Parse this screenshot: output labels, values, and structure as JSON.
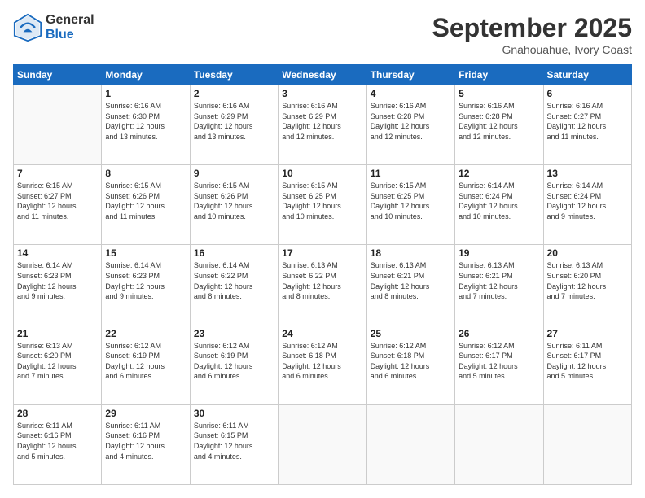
{
  "header": {
    "logo_line1": "General",
    "logo_line2": "Blue",
    "month": "September 2025",
    "location": "Gnahouahue, Ivory Coast"
  },
  "days_of_week": [
    "Sunday",
    "Monday",
    "Tuesday",
    "Wednesday",
    "Thursday",
    "Friday",
    "Saturday"
  ],
  "weeks": [
    [
      {
        "day": "",
        "info": ""
      },
      {
        "day": "1",
        "info": "Sunrise: 6:16 AM\nSunset: 6:30 PM\nDaylight: 12 hours\nand 13 minutes."
      },
      {
        "day": "2",
        "info": "Sunrise: 6:16 AM\nSunset: 6:29 PM\nDaylight: 12 hours\nand 13 minutes."
      },
      {
        "day": "3",
        "info": "Sunrise: 6:16 AM\nSunset: 6:29 PM\nDaylight: 12 hours\nand 12 minutes."
      },
      {
        "day": "4",
        "info": "Sunrise: 6:16 AM\nSunset: 6:28 PM\nDaylight: 12 hours\nand 12 minutes."
      },
      {
        "day": "5",
        "info": "Sunrise: 6:16 AM\nSunset: 6:28 PM\nDaylight: 12 hours\nand 12 minutes."
      },
      {
        "day": "6",
        "info": "Sunrise: 6:16 AM\nSunset: 6:27 PM\nDaylight: 12 hours\nand 11 minutes."
      }
    ],
    [
      {
        "day": "7",
        "info": "Sunrise: 6:15 AM\nSunset: 6:27 PM\nDaylight: 12 hours\nand 11 minutes."
      },
      {
        "day": "8",
        "info": "Sunrise: 6:15 AM\nSunset: 6:26 PM\nDaylight: 12 hours\nand 11 minutes."
      },
      {
        "day": "9",
        "info": "Sunrise: 6:15 AM\nSunset: 6:26 PM\nDaylight: 12 hours\nand 10 minutes."
      },
      {
        "day": "10",
        "info": "Sunrise: 6:15 AM\nSunset: 6:25 PM\nDaylight: 12 hours\nand 10 minutes."
      },
      {
        "day": "11",
        "info": "Sunrise: 6:15 AM\nSunset: 6:25 PM\nDaylight: 12 hours\nand 10 minutes."
      },
      {
        "day": "12",
        "info": "Sunrise: 6:14 AM\nSunset: 6:24 PM\nDaylight: 12 hours\nand 10 minutes."
      },
      {
        "day": "13",
        "info": "Sunrise: 6:14 AM\nSunset: 6:24 PM\nDaylight: 12 hours\nand 9 minutes."
      }
    ],
    [
      {
        "day": "14",
        "info": "Sunrise: 6:14 AM\nSunset: 6:23 PM\nDaylight: 12 hours\nand 9 minutes."
      },
      {
        "day": "15",
        "info": "Sunrise: 6:14 AM\nSunset: 6:23 PM\nDaylight: 12 hours\nand 9 minutes."
      },
      {
        "day": "16",
        "info": "Sunrise: 6:14 AM\nSunset: 6:22 PM\nDaylight: 12 hours\nand 8 minutes."
      },
      {
        "day": "17",
        "info": "Sunrise: 6:13 AM\nSunset: 6:22 PM\nDaylight: 12 hours\nand 8 minutes."
      },
      {
        "day": "18",
        "info": "Sunrise: 6:13 AM\nSunset: 6:21 PM\nDaylight: 12 hours\nand 8 minutes."
      },
      {
        "day": "19",
        "info": "Sunrise: 6:13 AM\nSunset: 6:21 PM\nDaylight: 12 hours\nand 7 minutes."
      },
      {
        "day": "20",
        "info": "Sunrise: 6:13 AM\nSunset: 6:20 PM\nDaylight: 12 hours\nand 7 minutes."
      }
    ],
    [
      {
        "day": "21",
        "info": "Sunrise: 6:13 AM\nSunset: 6:20 PM\nDaylight: 12 hours\nand 7 minutes."
      },
      {
        "day": "22",
        "info": "Sunrise: 6:12 AM\nSunset: 6:19 PM\nDaylight: 12 hours\nand 6 minutes."
      },
      {
        "day": "23",
        "info": "Sunrise: 6:12 AM\nSunset: 6:19 PM\nDaylight: 12 hours\nand 6 minutes."
      },
      {
        "day": "24",
        "info": "Sunrise: 6:12 AM\nSunset: 6:18 PM\nDaylight: 12 hours\nand 6 minutes."
      },
      {
        "day": "25",
        "info": "Sunrise: 6:12 AM\nSunset: 6:18 PM\nDaylight: 12 hours\nand 6 minutes."
      },
      {
        "day": "26",
        "info": "Sunrise: 6:12 AM\nSunset: 6:17 PM\nDaylight: 12 hours\nand 5 minutes."
      },
      {
        "day": "27",
        "info": "Sunrise: 6:11 AM\nSunset: 6:17 PM\nDaylight: 12 hours\nand 5 minutes."
      }
    ],
    [
      {
        "day": "28",
        "info": "Sunrise: 6:11 AM\nSunset: 6:16 PM\nDaylight: 12 hours\nand 5 minutes."
      },
      {
        "day": "29",
        "info": "Sunrise: 6:11 AM\nSunset: 6:16 PM\nDaylight: 12 hours\nand 4 minutes."
      },
      {
        "day": "30",
        "info": "Sunrise: 6:11 AM\nSunset: 6:15 PM\nDaylight: 12 hours\nand 4 minutes."
      },
      {
        "day": "",
        "info": ""
      },
      {
        "day": "",
        "info": ""
      },
      {
        "day": "",
        "info": ""
      },
      {
        "day": "",
        "info": ""
      }
    ]
  ]
}
